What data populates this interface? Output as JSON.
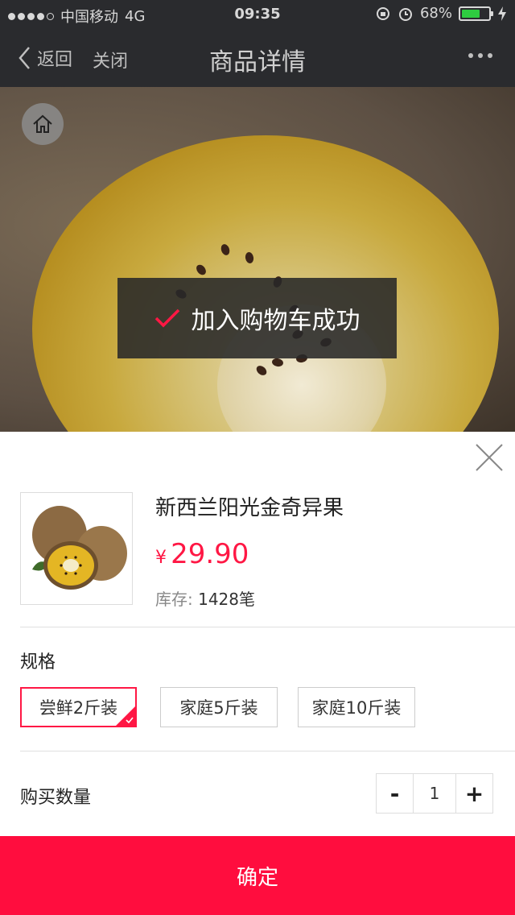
{
  "status_bar": {
    "carrier": "中国移动",
    "network": "4G",
    "time": "09:35",
    "battery": "68%",
    "battery_level": 0.68
  },
  "nav": {
    "back_label": "返回",
    "close_label": "关闭",
    "title": "商品详情"
  },
  "toast": {
    "message": "加入购物车成功"
  },
  "product": {
    "name": "新西兰阳光金奇异果",
    "currency": "¥",
    "price": "29.90",
    "stock_label": "库存:",
    "stock_value": "1428笔"
  },
  "spec": {
    "title": "规格",
    "options": [
      {
        "label": "尝鲜2斤装",
        "selected": true
      },
      {
        "label": "家庭5斤装",
        "selected": false
      },
      {
        "label": "家庭10斤装",
        "selected": false
      }
    ]
  },
  "quantity": {
    "label": "购买数量",
    "minus": "-",
    "value": "1",
    "plus": "+"
  },
  "confirm_label": "确定",
  "colors": {
    "accent": "#ff0d3e",
    "price": "#ff1744",
    "nav_bg": "#2a2b2e"
  }
}
